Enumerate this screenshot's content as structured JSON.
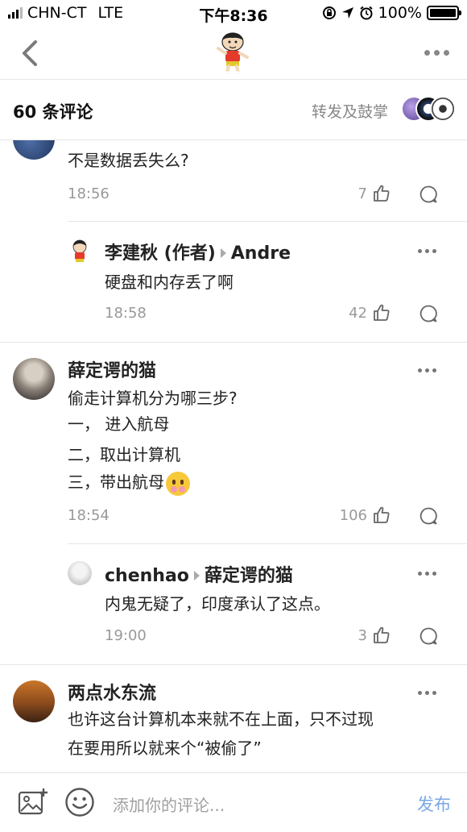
{
  "status_bar": {
    "carrier": "CHN-CT",
    "network": "LTE",
    "time": "下午8:36",
    "battery": "100%"
  },
  "header": {
    "comment_count": "60 条评论",
    "repost_label": "转发及鼓掌"
  },
  "comments": [
    {
      "text": "不是数据丢失么?",
      "time": "18:56",
      "likes": "7"
    },
    {
      "author": "李建秋 (作者)",
      "reply_to": "Andre",
      "text": "硬盘和内存丢了啊",
      "time": "18:58",
      "likes": "42"
    },
    {
      "author": "薛定谔的猫",
      "lines": [
        "偷走计算机分为哪三步?",
        "一，  进入航母",
        "二，取出计算机",
        "三，带出航母"
      ],
      "time": "18:54",
      "likes": "106"
    },
    {
      "author": "chenhao",
      "reply_to": "薛定谔的猫",
      "text": "内鬼无疑了，印度承认了这点。",
      "time": "19:00",
      "likes": "3"
    },
    {
      "author": "两点水东流",
      "lines": [
        "也许这台计算机本来就不在上面，只不过现",
        "在要用所以就来个“被偷了”"
      ]
    }
  ],
  "input_bar": {
    "placeholder": "添加你的评论...",
    "publish_label": "发布"
  },
  "colors": {
    "accent": "#7aa7e6",
    "muted": "#999999"
  }
}
